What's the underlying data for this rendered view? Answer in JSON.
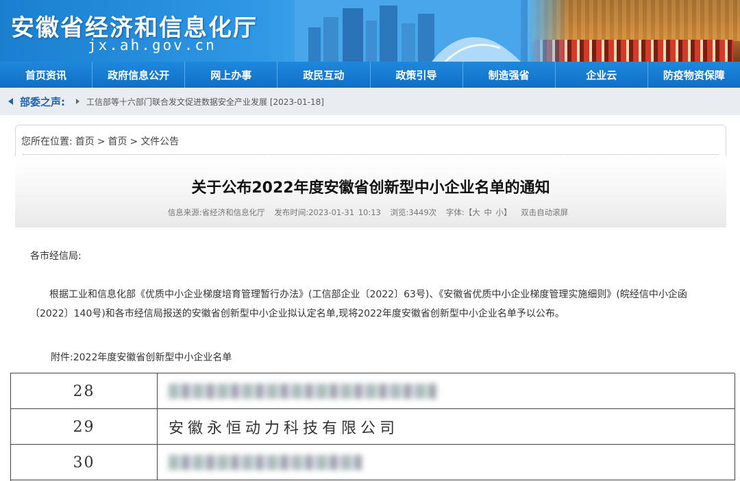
{
  "header": {
    "site_title": "安徽省经济和信息化厅",
    "domain": "jx.ah.gov.cn",
    "brand_color": "#1a7fd0"
  },
  "nav": {
    "items": [
      "首页资讯",
      "政府信息公开",
      "网上办事",
      "政民互动",
      "政策引导",
      "制造强省",
      "企业云",
      "防疫物资保障"
    ]
  },
  "ticker": {
    "label": "部委之声:",
    "news": "工信部等十六部门联合发文促进数据安全产业发展 [2023-01-18]"
  },
  "breadcrumb": {
    "prefix": "您所在位置:",
    "items": [
      "首页",
      "首页",
      "文件公告"
    ],
    "separator": ">"
  },
  "article": {
    "title": "关于公布2022年度安徽省创新型中小企业名单的通知",
    "meta": {
      "source": "信息来源:省经济和信息化厅",
      "published": "发布时间:2023-01-31 10:13",
      "views": "浏览:3449次",
      "font_size": "字体:【大 中 小】",
      "autoscroll": "双击自动滚屏"
    },
    "salutation": "各市经信局:",
    "paragraph": "根据工业和信息化部《优质中小企业梯度培育管理暂行办法》(工信部企业〔2022〕63号)、《安徽省优质中小企业梯度管理实施细则》(皖经信中小企函〔2022〕140号)和各市经信局报送的安徽省创新型中小企业拟认定名单,现将2022年度安徽省创新型中小企业名单予以公布。",
    "attachment": "附件:2022年度安徽省创新型中小企业名单"
  },
  "table": {
    "rows": [
      {
        "num": "28",
        "name": "",
        "blurred": true
      },
      {
        "num": "29",
        "name": "安徽永恒动力科技有限公司",
        "blurred": false
      },
      {
        "num": "30",
        "name": "",
        "blurred": true
      }
    ]
  }
}
